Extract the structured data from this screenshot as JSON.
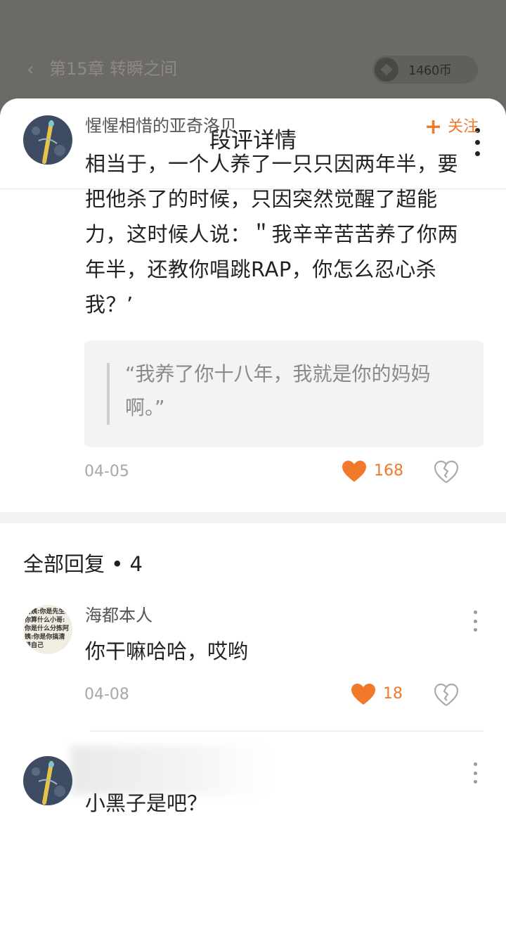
{
  "background_header": {
    "chapter_title": "第15章 转瞬之间",
    "coin_balance": "1460币"
  },
  "sheet": {
    "title": "段评详情"
  },
  "main_comment": {
    "username": "惺惺相惜的亚奇洛贝",
    "follow_label": "关注",
    "text": "相当于，一个人养了一只只因两年半，要把他杀了的时候，只因突然觉醒了超能力，这时候人说：＂我辛辛苦苦养了你两年半，还教你唱跳RAP，你怎么忍心杀我？’",
    "quote": "“我养了你十八年，我就是你的妈妈啊。”",
    "date": "04-05",
    "likes": "168"
  },
  "replies_section": {
    "title": "全部回复 • 4"
  },
  "replies": [
    {
      "username": "海都本人",
      "text": "你干嘛哈哈，哎哟",
      "date": "04-08",
      "likes": "18"
    },
    {
      "text": "小黑子是吧？"
    }
  ],
  "colors": {
    "accent": "#f07a2a",
    "dim_background": "#6c6a65"
  }
}
